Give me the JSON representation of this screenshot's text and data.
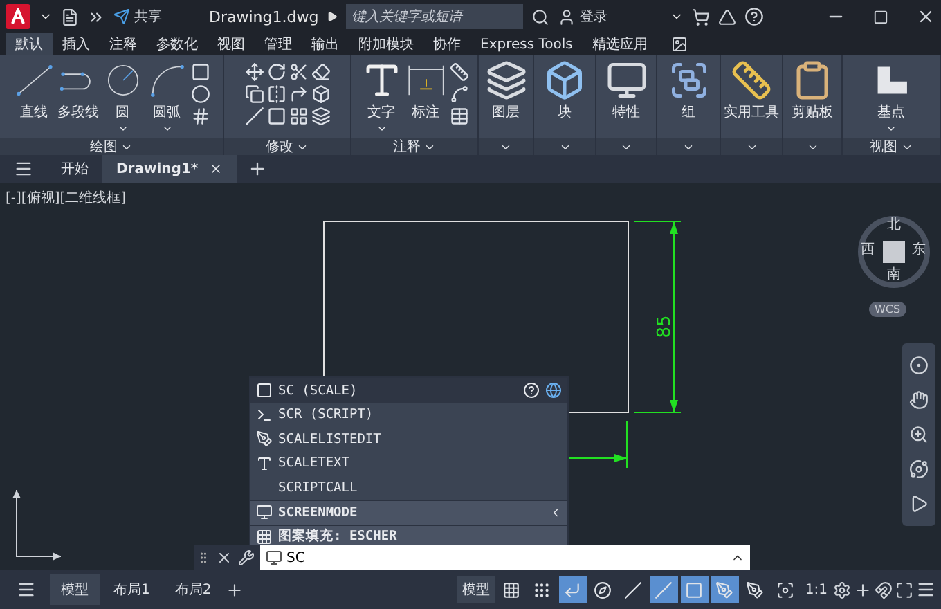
{
  "title_bar": {
    "share": "共享",
    "file_name": "Drawing1.dwg",
    "search": {
      "placeholder": "键入关键字或短语"
    },
    "sign_in": "登录"
  },
  "ribbon_tabs": [
    {
      "label": "默认",
      "selected": true
    },
    {
      "label": "插入",
      "selected": false
    },
    {
      "label": "注释",
      "selected": false
    },
    {
      "label": "参数化",
      "selected": false
    },
    {
      "label": "视图",
      "selected": false
    },
    {
      "label": "管理",
      "selected": false
    },
    {
      "label": "输出",
      "selected": false
    },
    {
      "label": "附加模块",
      "selected": false
    },
    {
      "label": "协作",
      "selected": false
    },
    {
      "label": "Express Tools",
      "selected": false
    },
    {
      "label": "精选应用",
      "selected": false
    }
  ],
  "ribbon_panels": [
    {
      "title": "绘图",
      "kind": "draw",
      "tools": [
        {
          "label": "直线",
          "kind": "line",
          "menu": false
        },
        {
          "label": "多段线",
          "kind": "polyline",
          "menu": false
        },
        {
          "label": "圆",
          "kind": "circle",
          "menu": true
        },
        {
          "label": "圆弧",
          "kind": "arc",
          "menu": true
        }
      ]
    },
    {
      "title": "修改",
      "kind": "modify"
    },
    {
      "title": "注释",
      "kind": "annotate",
      "tools": [
        {
          "label": "文字",
          "kind": "text",
          "menu": true
        },
        {
          "label": "标注",
          "kind": "dimension",
          "menu": false
        }
      ]
    },
    {
      "kind": "single",
      "tools": [
        {
          "label": "图层",
          "kind": "layers",
          "menu": false
        }
      ]
    },
    {
      "kind": "single",
      "tools": [
        {
          "label": "块",
          "kind": "block",
          "menu": false
        }
      ]
    },
    {
      "kind": "single",
      "tools": [
        {
          "label": "特性",
          "kind": "properties",
          "menu": false
        }
      ]
    },
    {
      "kind": "single",
      "tools": [
        {
          "label": "组",
          "kind": "group",
          "menu": false
        }
      ]
    },
    {
      "kind": "single",
      "tools": [
        {
          "label": "实用工具",
          "kind": "utilities",
          "menu": false
        }
      ]
    },
    {
      "kind": "single",
      "tools": [
        {
          "label": "剪贴板",
          "kind": "clipboard",
          "menu": false
        }
      ]
    },
    {
      "title": "视图",
      "kind": "view",
      "tools": [
        {
          "label": "基点",
          "kind": "basepoint",
          "menu": true
        }
      ]
    }
  ],
  "doc_tabs": [
    {
      "label": "开始",
      "selected": false
    },
    {
      "label": "Drawing1*",
      "selected": true
    }
  ],
  "viewport": {
    "label": "[-][俯视][二维线框]",
    "dimension": "85",
    "view_cube": {
      "north": "北",
      "south": "南",
      "west": "西",
      "east": "东",
      "ucs": "WCS"
    }
  },
  "autocomplete": {
    "header": "SC (SCALE)",
    "items": [
      {
        "label": "SCR (SCRIPT)",
        "kind": "script"
      },
      {
        "label": "SCALELISTEDIT",
        "kind": "scale-list"
      },
      {
        "label": "SCALETEXT",
        "kind": "scale-text"
      },
      {
        "label": "SCRIPTCALL",
        "kind": "plain"
      },
      {
        "label": "SCREENMODE",
        "kind": "variable"
      },
      {
        "label": "图案填充: ESCHER",
        "kind": "hatch"
      }
    ]
  },
  "command_line": {
    "value": "SC"
  },
  "layout_tabs": [
    {
      "label": "模型",
      "selected": true
    },
    {
      "label": "布局1",
      "selected": false
    },
    {
      "label": "布局2",
      "selected": false
    }
  ],
  "status_bar": {
    "space": "模型",
    "toggles": [
      {
        "kind": "grid",
        "on": false
      },
      {
        "kind": "snap",
        "on": false
      },
      {
        "kind": "ortho",
        "on": true
      },
      {
        "kind": "polar",
        "on": false
      },
      {
        "kind": "isometric",
        "on": false
      },
      {
        "kind": "tracking",
        "on": true
      },
      {
        "kind": "osnap",
        "on": true
      },
      {
        "kind": "annotation-visibility",
        "on": true
      },
      {
        "kind": "auto-scale",
        "on": false
      },
      {
        "kind": "annotation-scale",
        "on": false
      }
    ],
    "scale": "1:1"
  }
}
